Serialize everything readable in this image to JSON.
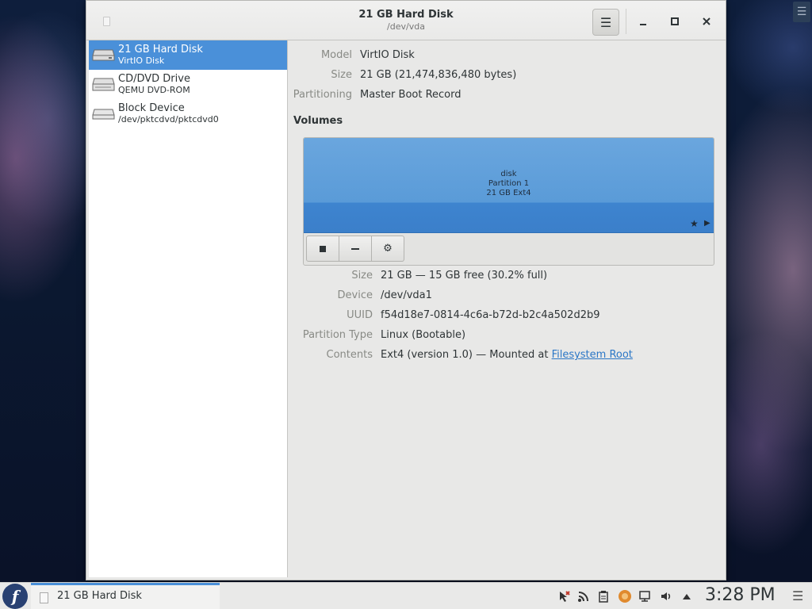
{
  "window": {
    "title": "21 GB Hard Disk",
    "subtitle": "/dev/vda",
    "menu_icon": "hamburger-icon",
    "buttons": {
      "minimize": "minimize-icon",
      "maximize": "maximize-icon",
      "close": "close-icon"
    }
  },
  "sidebar": {
    "drives": [
      {
        "name": "21 GB Hard Disk",
        "sub": "VirtIO Disk",
        "icon": "hard-disk-icon",
        "selected": true
      },
      {
        "name": "CD/DVD Drive",
        "sub": "QEMU DVD-ROM",
        "icon": "optical-drive-icon",
        "selected": false
      },
      {
        "name": "Block Device",
        "sub": "/dev/pktcdvd/pktcdvd0",
        "icon": "block-device-icon",
        "selected": false
      }
    ]
  },
  "drive_info": {
    "model_label": "Model",
    "model": "VirtIO Disk",
    "size_label": "Size",
    "size": "21 GB (21,474,836,480 bytes)",
    "partitioning_label": "Partitioning",
    "partitioning": "Master Boot Record"
  },
  "volumes": {
    "title": "Volumes",
    "partition": {
      "line1": "disk",
      "line2": "Partition 1",
      "line3": "21 GB Ext4"
    },
    "tools": [
      "stop-icon",
      "minus-icon",
      "gear-icon"
    ]
  },
  "partition_info": {
    "size_label": "Size",
    "size": "21 GB — 15 GB free (30.2% full)",
    "device_label": "Device",
    "device": "/dev/vda1",
    "uuid_label": "UUID",
    "uuid": "f54d18e7-0814-4c6a-b72d-b2c4a502d2b9",
    "type_label": "Partition Type",
    "type": "Linux (Bootable)",
    "contents_label": "Contents",
    "contents": "Ext4 (version 1.0) — Mounted at ",
    "contents_link": "Filesystem Root"
  },
  "taskbar": {
    "task_label": "21 GB Hard Disk",
    "clock": "3:28 PM",
    "tray": [
      "pointer-icon",
      "rss-icon",
      "clipboard-icon",
      "app-icon",
      "network-icon",
      "volume-icon",
      "up-arrow-icon"
    ]
  },
  "colors": {
    "selection": "#4a90d9",
    "partition": "#5a9bd8",
    "link": "#2a76c6"
  }
}
